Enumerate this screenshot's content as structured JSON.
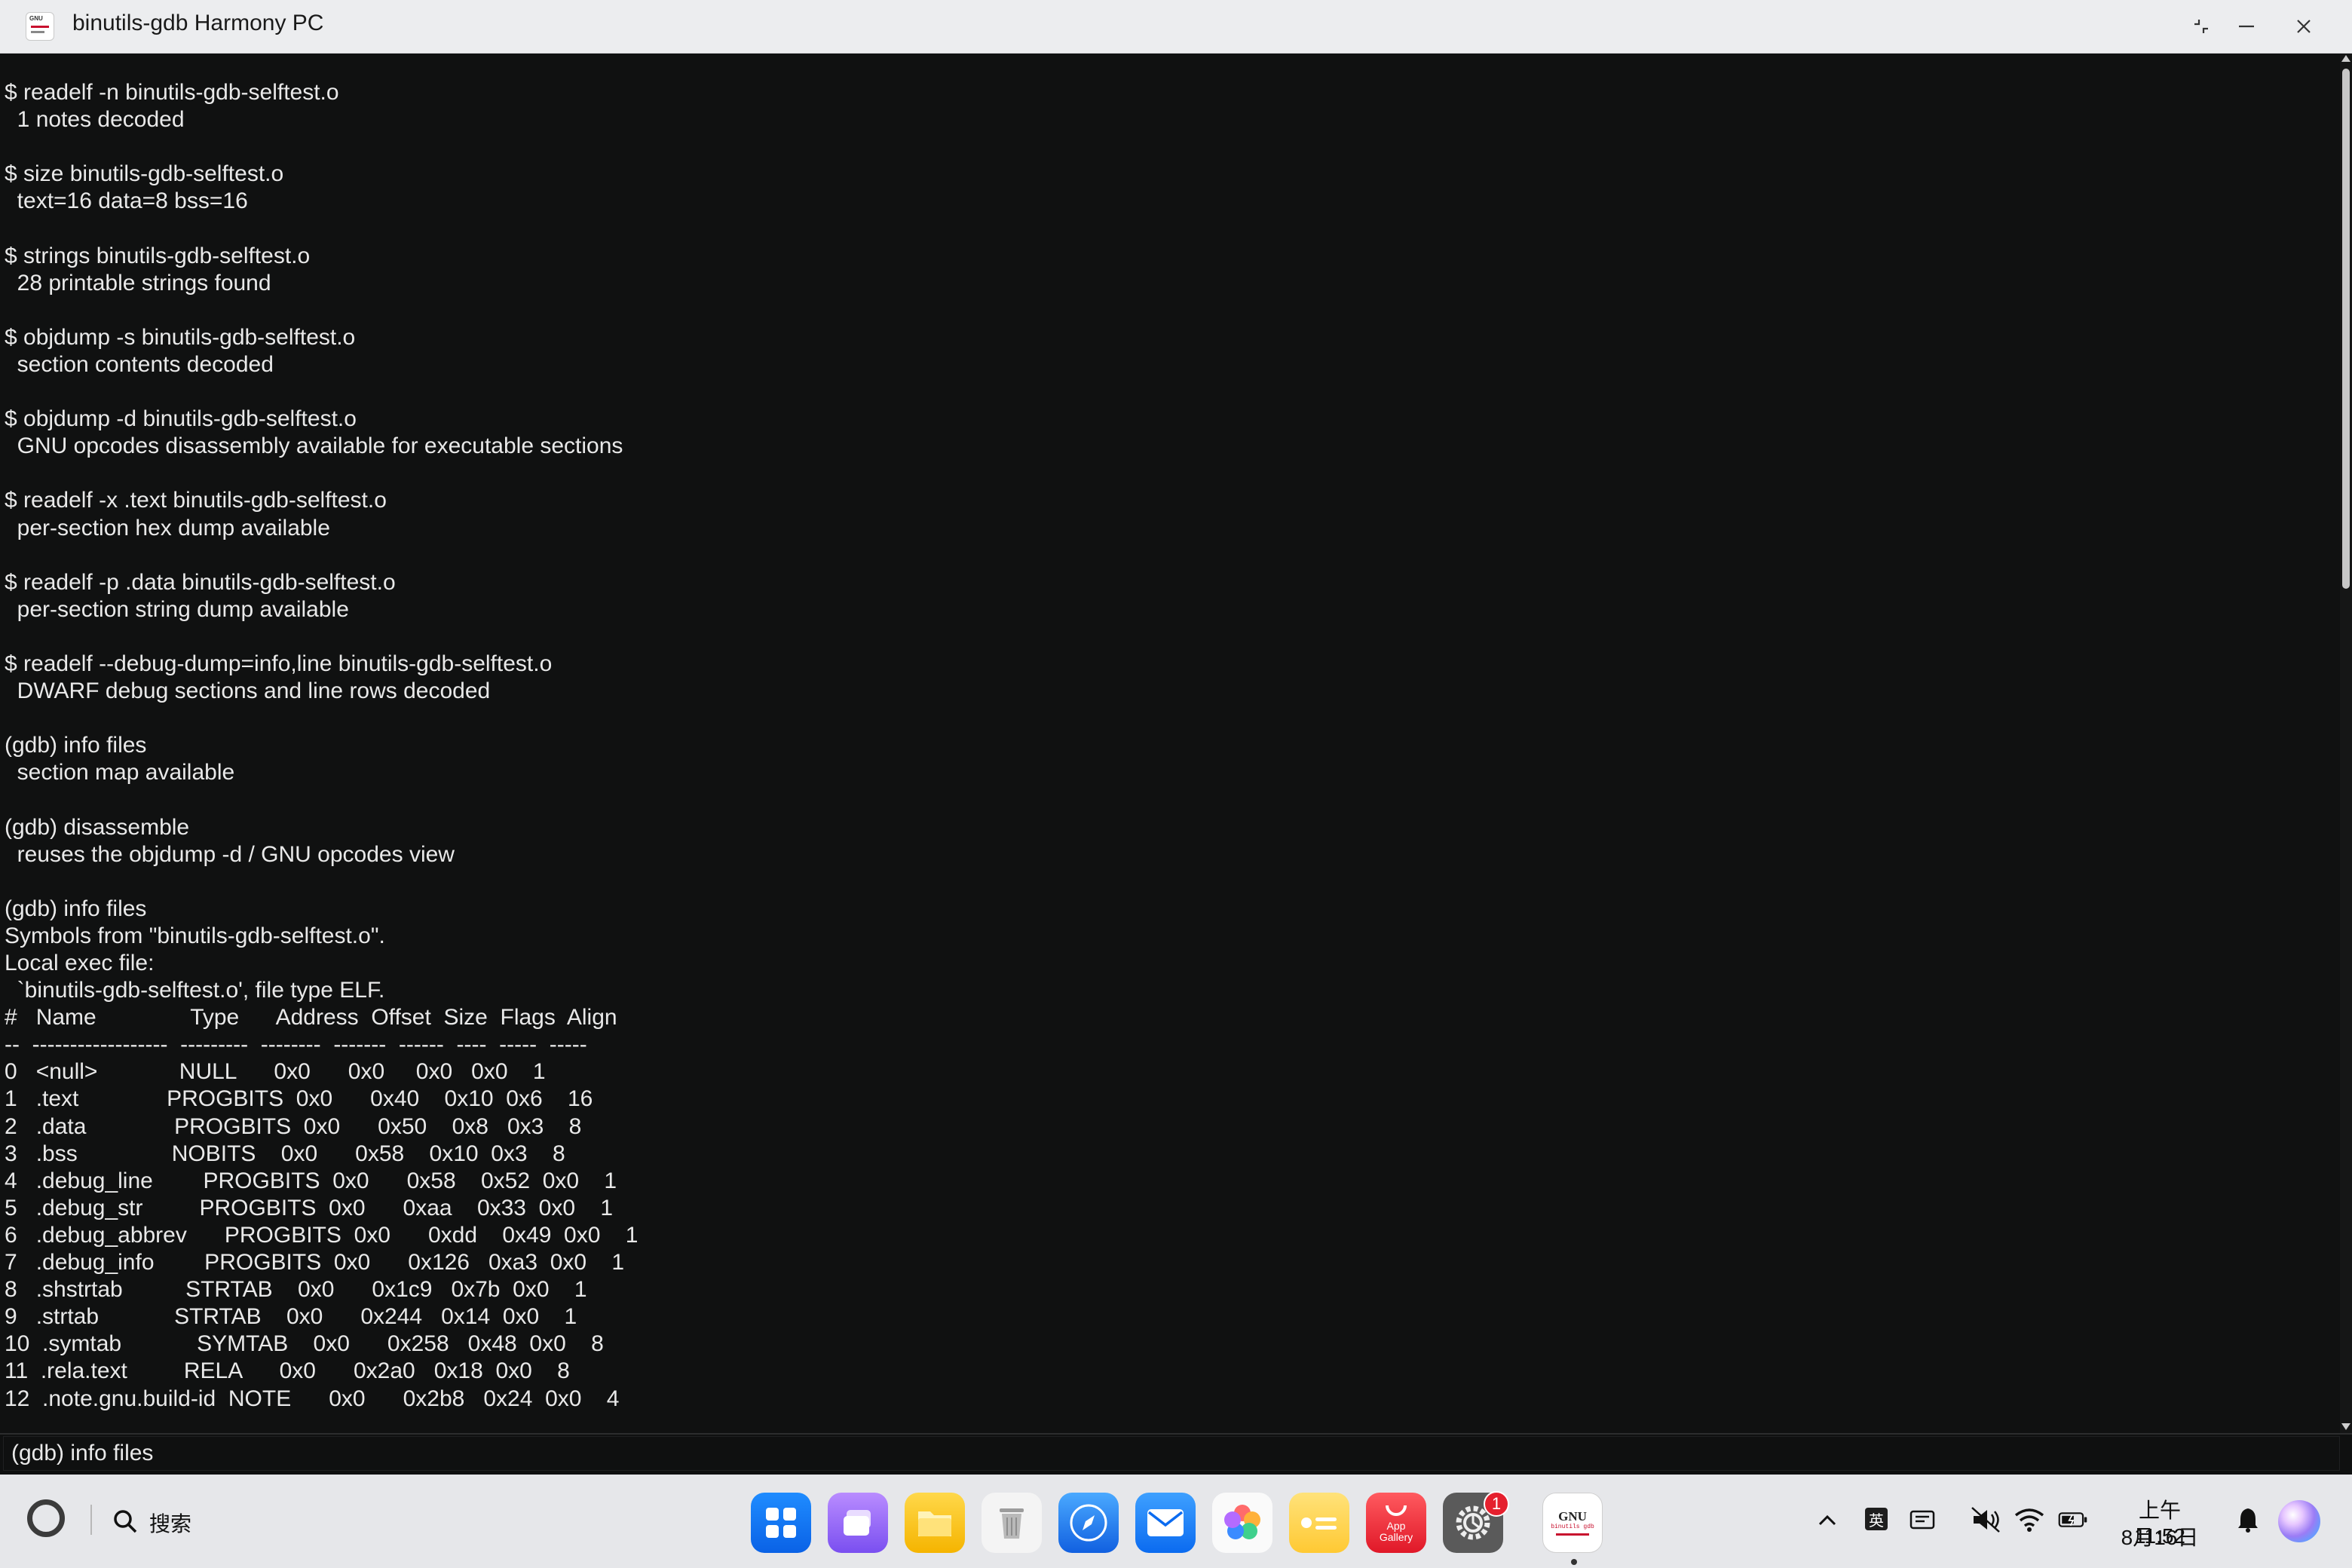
{
  "window": {
    "title": "binutils-gdb Harmony PC",
    "app_icon_text": "GNU"
  },
  "terminal": {
    "lines": [
      "$ readelf -n binutils-gdb-selftest.o",
      "  1 notes decoded",
      "",
      "$ size binutils-gdb-selftest.o",
      "  text=16 data=8 bss=16",
      "",
      "$ strings binutils-gdb-selftest.o",
      "  28 printable strings found",
      "",
      "$ objdump -s binutils-gdb-selftest.o",
      "  section contents decoded",
      "",
      "$ objdump -d binutils-gdb-selftest.o",
      "  GNU opcodes disassembly available for executable sections",
      "",
      "$ readelf -x .text binutils-gdb-selftest.o",
      "  per-section hex dump available",
      "",
      "$ readelf -p .data binutils-gdb-selftest.o",
      "  per-section string dump available",
      "",
      "$ readelf --debug-dump=info,line binutils-gdb-selftest.o",
      "  DWARF debug sections and line rows decoded",
      "",
      "(gdb) info files",
      "  section map available",
      "",
      "(gdb) disassemble",
      "  reuses the objdump -d / GNU opcodes view",
      "",
      "(gdb) info files",
      "Symbols from \"binutils-gdb-selftest.o\".",
      "Local exec file:",
      "  `binutils-gdb-selftest.o', file type ELF.",
      "#   Name               Type      Address  Offset  Size  Flags  Align",
      "--  ------------------  ---------  --------  -------  ------  ----  -----  -----",
      "0   <null>             NULL      0x0      0x0     0x0   0x0    1",
      "1   .text              PROGBITS  0x0      0x40    0x10  0x6    16",
      "2   .data              PROGBITS  0x0      0x50    0x8   0x3    8",
      "3   .bss               NOBITS    0x0      0x58    0x10  0x3    8",
      "4   .debug_line        PROGBITS  0x0      0x58    0x52  0x0    1",
      "5   .debug_str         PROGBITS  0x0      0xaa    0x33  0x0    1",
      "6   .debug_abbrev      PROGBITS  0x0      0xdd    0x49  0x0    1",
      "7   .debug_info        PROGBITS  0x0      0x126   0xa3  0x0    1",
      "8   .shstrtab          STRTAB    0x0      0x1c9   0x7b  0x0    1",
      "9   .strtab            STRTAB    0x0      0x244   0x14  0x0    1",
      "10  .symtab            SYMTAB    0x0      0x258   0x48  0x0    8",
      "11  .rela.text         RELA      0x0      0x2a0   0x18  0x0    8",
      "12  .note.gnu.build-id  NOTE      0x0      0x2b8   0x24  0x0    4"
    ]
  },
  "input": {
    "value": "(gdb) info files"
  },
  "taskbar": {
    "search_label": "搜索",
    "settings_badge": "1",
    "app_gallery_label": "App Gallery",
    "gnu_icon_text": "GNU",
    "gnu_icon_sub": "binutils gdb",
    "ime_label": "英",
    "clock_time": "上午11:52",
    "clock_date": "8月16日"
  },
  "colors": {
    "terminal_bg": "#101111",
    "terminal_fg": "#e9e9e9",
    "titlebar_bg": "#ecedef",
    "taskbar_bg": "#e6e7ea",
    "badge": "#e5202e"
  }
}
